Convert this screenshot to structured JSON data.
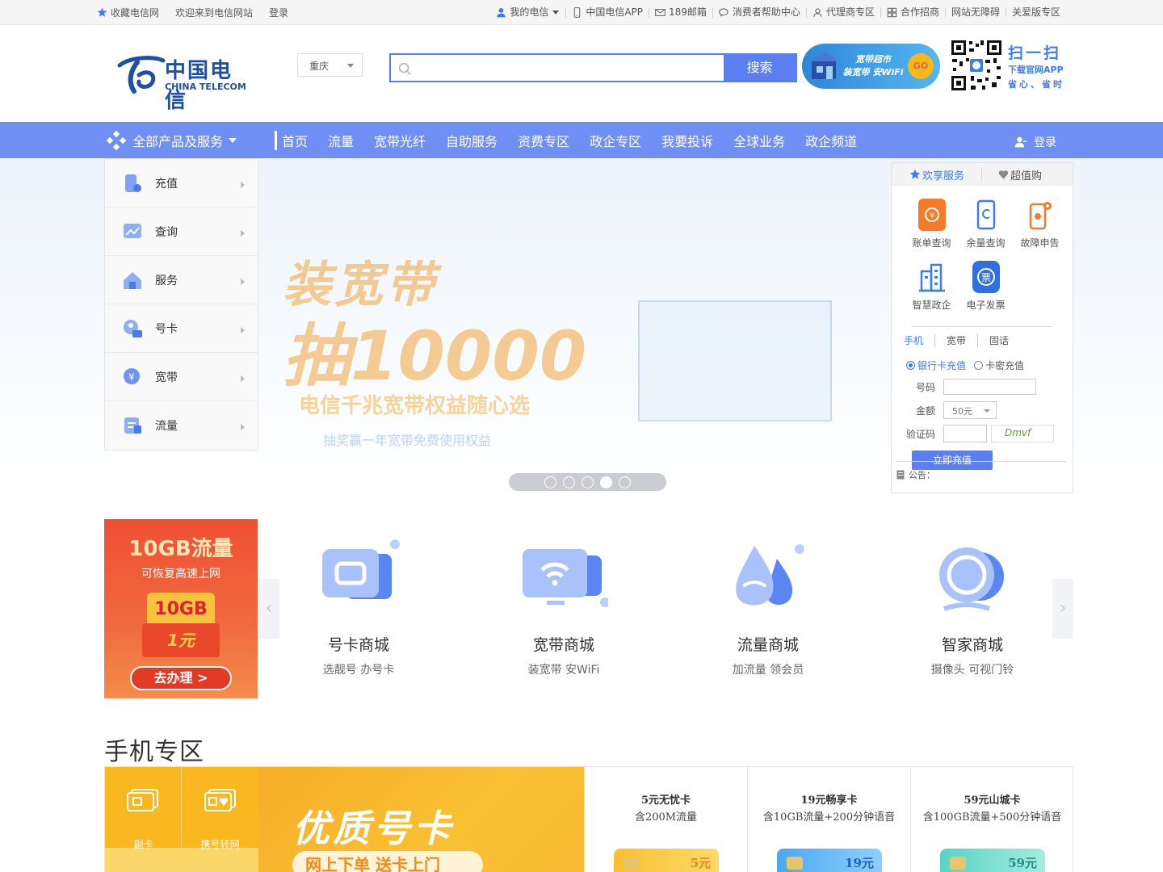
{
  "topbar": {
    "left": [
      "收藏电信网",
      "欢迎来到电信网站",
      "登录"
    ],
    "right": [
      "我的电信",
      "中国电信APP",
      "189邮箱",
      "消费者帮助中心",
      "代理商专区",
      "合作招商",
      "网站无障碍",
      "关爱版专区"
    ]
  },
  "header": {
    "logo_cn": "中国电信",
    "logo_en": "CHINA TELECOM",
    "city": "重庆",
    "search_button": "搜索",
    "search_placeholder": "",
    "promo_line1": "宽带超市",
    "promo_line2": "装宽带 安WiFi",
    "promo_go": "GO",
    "scan_title": "扫一扫",
    "scan_line1": "下载官网APP",
    "scan_line2": "省心、省时"
  },
  "nav": {
    "all_products": "全部产品及服务",
    "links": [
      "首页",
      "流量",
      "宽带光纤",
      "自助服务",
      "资费专区",
      "政企专区",
      "我要投诉",
      "全球业务",
      "政企频道"
    ],
    "login": "登录"
  },
  "sidenav": [
    "充值",
    "查询",
    "服务",
    "号卡",
    "宽带",
    "流量"
  ],
  "slide": {
    "line1": "装宽带",
    "line2": "抽10000",
    "line3": "电信千兆宽带权益随心选",
    "line4": "抽奖赢一年宽带免费使用权益",
    "active_dot": 4,
    "dot_count": 5
  },
  "panel": {
    "tab_active": "欢享服务",
    "tab_other": "超值购",
    "services": [
      "账单查询",
      "余量查询",
      "故障申告",
      "智慧政企",
      "电子发票"
    ],
    "charge_tabs": [
      "手机",
      "宽带",
      "固话"
    ],
    "radio_bank": "银行卡充值",
    "radio_card": "卡密充值",
    "label_number": "号码",
    "label_amount": "金额",
    "amount_value": "50元",
    "label_captcha": "验证码",
    "captcha_text": "Dmvf",
    "charge_button": "立即充值",
    "notice": "公告："
  },
  "features": {
    "ad_title": "10GB流量",
    "ad_sub": "可恢复高速上网",
    "ad_badge": "10GB",
    "ad_price": "1元",
    "ad_button": "去办理 >",
    "cards": [
      {
        "title": "号卡商城",
        "sub": "选靓号 办号卡"
      },
      {
        "title": "宽带商城",
        "sub": "装宽带 安WiFi"
      },
      {
        "title": "流量商城",
        "sub": "加流量 领会员"
      },
      {
        "title": "智家商城",
        "sub": "摄像头 可视门铃"
      }
    ]
  },
  "zone": {
    "title": "手机专区",
    "tile1": "副卡",
    "tile2": "携号转网",
    "hero1": "优质号卡",
    "hero2": "网上下单 送卡上门",
    "cards": [
      {
        "title": "5元无忧卡",
        "sub": "含200M流量",
        "price": "5元"
      },
      {
        "title": "19元畅享卡",
        "sub": "含10GB流量+200分钟语音",
        "price": "19元"
      },
      {
        "title": "59元山城卡",
        "sub": "含100GB流量+500分钟语音",
        "price": "59元"
      }
    ]
  },
  "colors": {
    "accent": "#5b7ff0",
    "nav": "#6f8ff4",
    "link": "#3d7bf0"
  }
}
